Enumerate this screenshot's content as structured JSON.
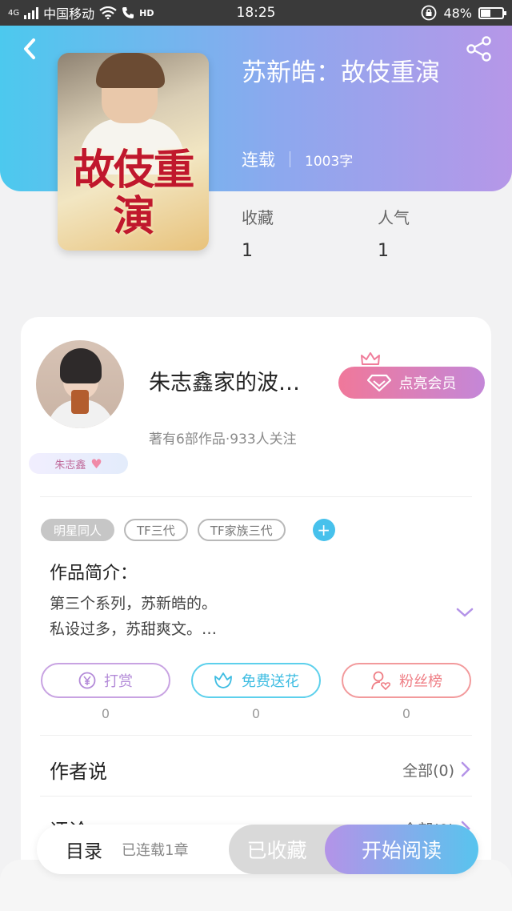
{
  "status_bar": {
    "network": "4G",
    "carrier": "中国移动",
    "hd": "HD",
    "time": "18:25",
    "battery_percent": "48%",
    "battery_level": 0.48
  },
  "header": {
    "back_icon": "chevron-left-icon",
    "share_icon": "share-icon",
    "title": "苏新皓：故伎重演",
    "status": "连载",
    "word_count": "1003字",
    "cover_art_text": "故伎重演",
    "stats": [
      {
        "label": "收藏",
        "value": "1"
      },
      {
        "label": "人气",
        "value": "1"
      }
    ]
  },
  "author": {
    "name": "朱志鑫家的波…",
    "summary": "著有6部作品·933人关注",
    "badge": "朱志鑫",
    "vip_button": "点亮会员"
  },
  "tags": [
    "明星同人",
    "TF三代",
    "TF家族三代"
  ],
  "intro": {
    "heading": "作品简介：",
    "line1": "第三个系列，苏新皓的。",
    "line2": "私设过多，苏甜爽文。…"
  },
  "actions": [
    {
      "label": "打赏",
      "count": "0",
      "icon": "yen-coin-icon"
    },
    {
      "label": "免费送花",
      "count": "0",
      "icon": "flower-icon"
    },
    {
      "label": "粉丝榜",
      "count": "0",
      "icon": "user-heart-icon"
    }
  ],
  "author_says": {
    "label": "作者说",
    "link": "全部(0)"
  },
  "comments": {
    "label": "评论",
    "link": "全部(0)"
  },
  "bottom_bar": {
    "toc": "目录",
    "chapters": "已连载1章",
    "favorited": "已收藏",
    "start_reading": "开始阅读"
  },
  "colors": {
    "header_gradient_start": "#4cc9ee",
    "header_gradient_end": "#b697e8",
    "accent_blue": "#47c1ec",
    "vip_pink": "#f0789a"
  }
}
